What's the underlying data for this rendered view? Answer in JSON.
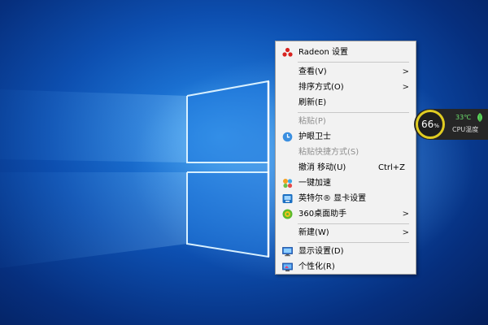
{
  "context_menu": {
    "items": [
      {
        "label": "Radeon 设置"
      },
      {
        "label": "查看(V)"
      },
      {
        "label": "排序方式(O)"
      },
      {
        "label": "刷新(E)"
      },
      {
        "label": "粘贴(P)"
      },
      {
        "label": "护眼卫士"
      },
      {
        "label": "粘贴快捷方式(S)"
      },
      {
        "label": "撤消 移动(U)",
        "shortcut": "Ctrl+Z"
      },
      {
        "label": "一键加速"
      },
      {
        "label": "英特尔® 显卡设置"
      },
      {
        "label": "360桌面助手"
      },
      {
        "label": "新建(W)"
      },
      {
        "label": "显示设置(D)"
      },
      {
        "label": "个性化(R)"
      }
    ]
  },
  "cpu_widget": {
    "percent": "66",
    "percent_unit": "%",
    "temperature": "33℃",
    "label": "CPU温度"
  },
  "colors": {
    "accent_ring": "#e0cc22",
    "temp_green": "#6fe36f",
    "menu_bg": "#f2f2f2"
  }
}
